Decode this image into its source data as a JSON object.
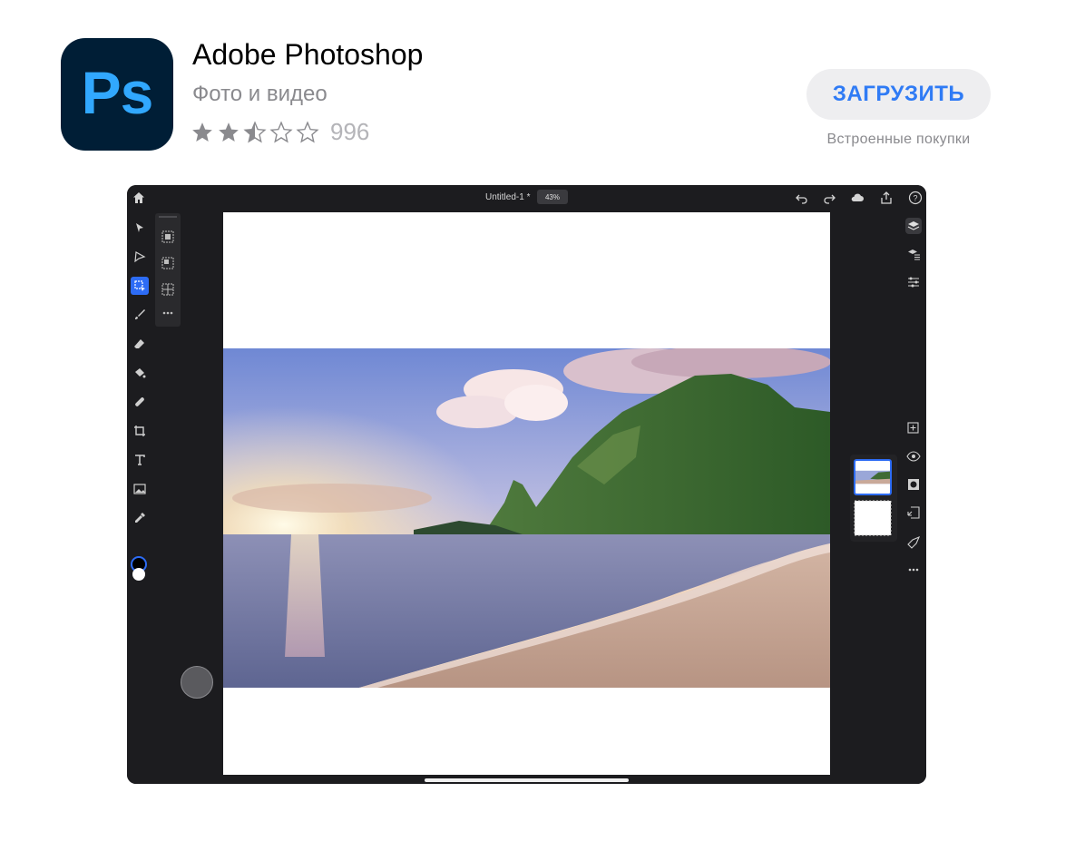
{
  "app": {
    "icon_text": "Ps",
    "name": "Adobe Photoshop",
    "category": "Фото и видео",
    "rating": 2.5,
    "rating_max": 5,
    "rating_count": "996",
    "get_button": "ЗАГРУЗИТЬ",
    "in_app_purchases": "Встроенные покупки"
  },
  "screenshot": {
    "doc_title": "Untitled-1 *",
    "zoom": "43%",
    "topbar_icons": [
      "home-icon",
      "undo-icon",
      "redo-icon",
      "cloud-icon",
      "share-icon",
      "help-icon"
    ],
    "tools": [
      "select-icon",
      "lasso-icon",
      "marquee-icon",
      "brush-icon",
      "eraser-icon",
      "fill-icon",
      "heal-icon",
      "crop-icon",
      "type-icon",
      "image-icon",
      "eyedropper-icon"
    ],
    "active_tool": "marquee-icon",
    "right_icons": [
      "layers-icon",
      "layer-properties-icon",
      "adjustments-icon",
      "add-layer-icon",
      "visibility-icon",
      "mask-icon",
      "import-icon",
      "clip-icon",
      "more-icon"
    ],
    "colors": {
      "accent": "#2d6cf5",
      "foreground": "#000000",
      "background": "#ffffff"
    }
  }
}
